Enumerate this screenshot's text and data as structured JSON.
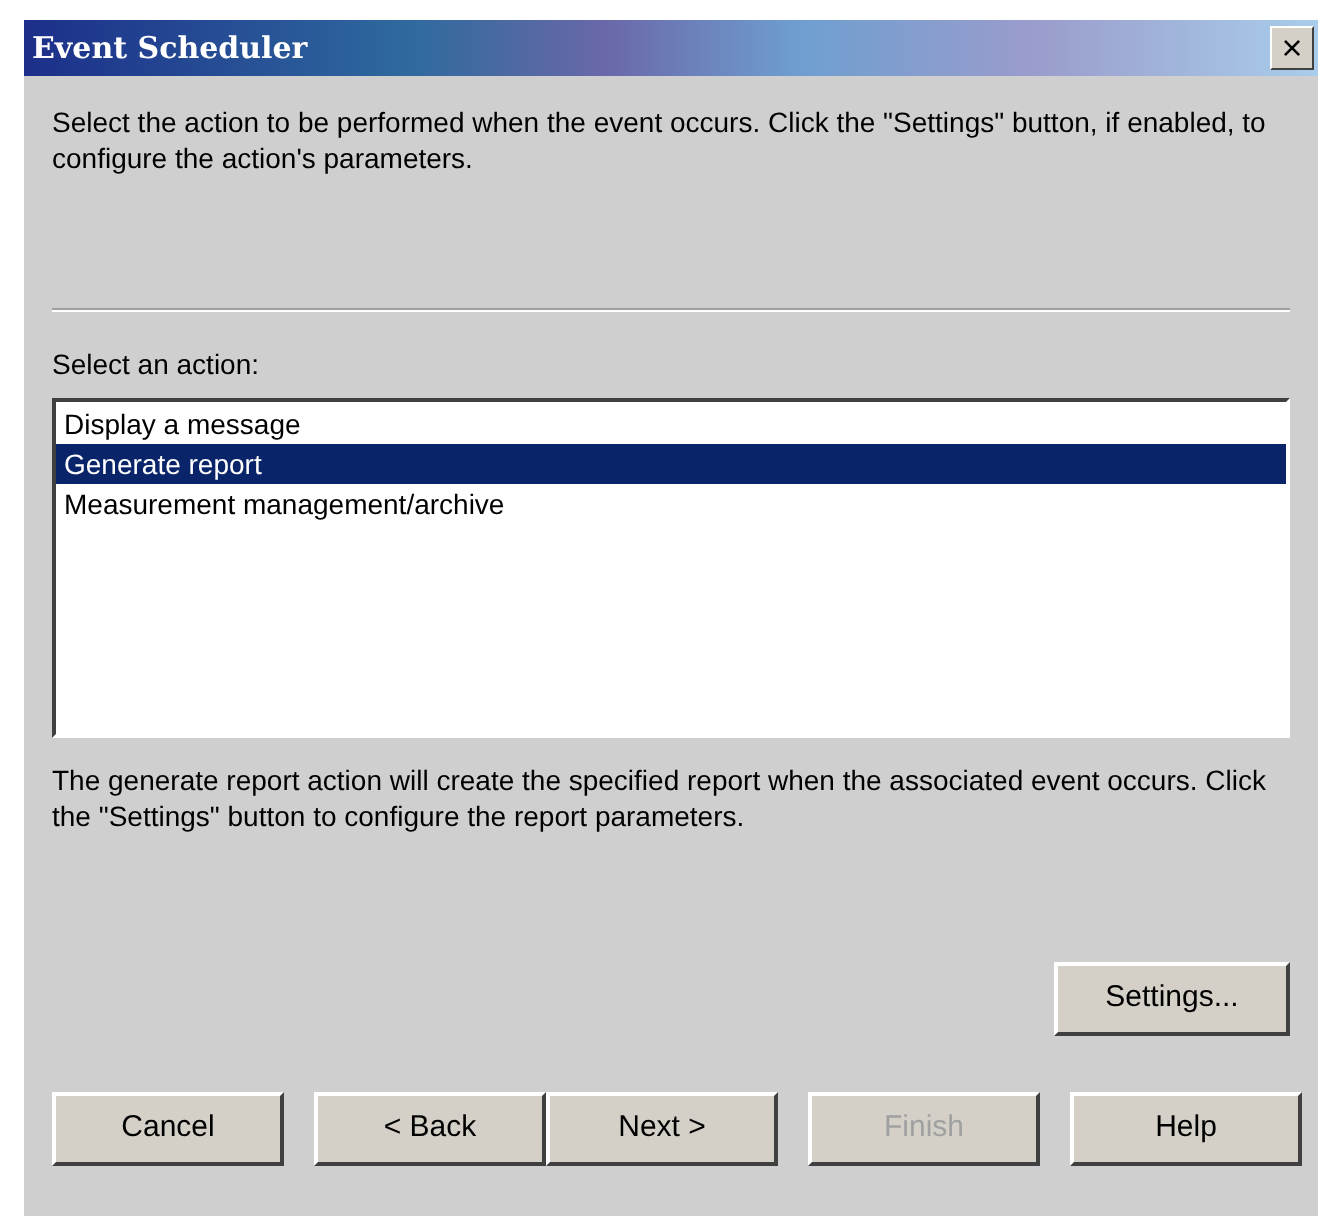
{
  "window": {
    "title": "Event Scheduler",
    "close": "×"
  },
  "intro": "Select the action to be performed when the event occurs.  Click the \"Settings\" button, if enabled, to configure the action's parameters.",
  "list_label": "Select an action:",
  "actions": [
    {
      "label": "Display a message",
      "selected": false
    },
    {
      "label": "Generate report",
      "selected": true
    },
    {
      "label": "Measurement management/archive",
      "selected": false
    }
  ],
  "description": "The generate report action will create the specified report when the associated event occurs.  Click the \"Settings\" button to configure the report parameters.",
  "settings_button": {
    "label": "Settings...",
    "disabled": false
  },
  "buttons": [
    {
      "label": "Cancel",
      "disabled": false
    },
    {
      "label": "< Back",
      "disabled": false
    },
    {
      "label": "Next >",
      "disabled": false
    },
    {
      "label": "Finish",
      "disabled": true
    },
    {
      "label": "Help",
      "disabled": false
    }
  ]
}
